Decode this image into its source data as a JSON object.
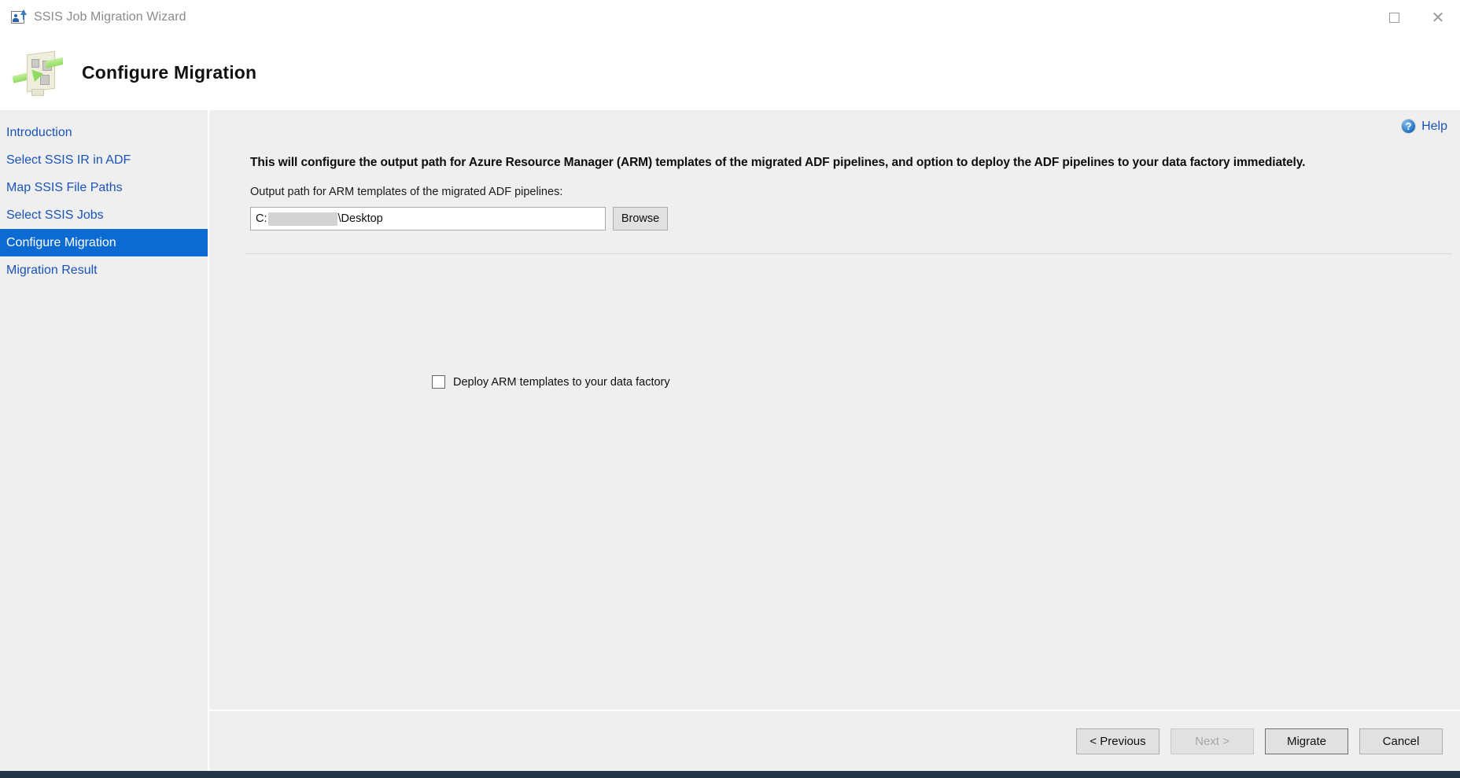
{
  "window": {
    "title": "SSIS Job Migration Wizard",
    "app_icon_name": "wizard-app-icon",
    "controls": {
      "maximize_label": "□",
      "close_label": "✕"
    }
  },
  "header": {
    "title": "Configure Migration",
    "icon_name": "migration-banner-icon"
  },
  "sidebar": {
    "items": [
      {
        "label": "Introduction",
        "active": false
      },
      {
        "label": "Select SSIS IR in ADF",
        "active": false
      },
      {
        "label": "Map SSIS File Paths",
        "active": false
      },
      {
        "label": "Select SSIS Jobs",
        "active": false
      },
      {
        "label": "Configure Migration",
        "active": true
      },
      {
        "label": "Migration Result",
        "active": false
      }
    ],
    "active_color": "#0b6bd3",
    "link_color": "#1a53b8"
  },
  "help": {
    "label": "Help",
    "icon_glyph": "?"
  },
  "main": {
    "intro_text": "This will configure the output path for Azure Resource Manager (ARM) templates of the migrated ADF pipelines, and option to deploy the ADF pipelines to your data factory immediately.",
    "output_path_label": "Output path for ARM templates of the migrated ADF pipelines:",
    "output_path_prefix": "C:",
    "output_path_suffix": "\\Desktop",
    "output_path_redacted": true,
    "browse_label": "Browse",
    "deploy_checkbox": {
      "label": "Deploy ARM templates to your data factory",
      "checked": false
    }
  },
  "footer": {
    "buttons": [
      {
        "label": "< Previous",
        "state": "enabled"
      },
      {
        "label": "Next >",
        "state": "disabled"
      },
      {
        "label": "Migrate",
        "state": "default"
      },
      {
        "label": "Cancel",
        "state": "enabled"
      }
    ]
  }
}
